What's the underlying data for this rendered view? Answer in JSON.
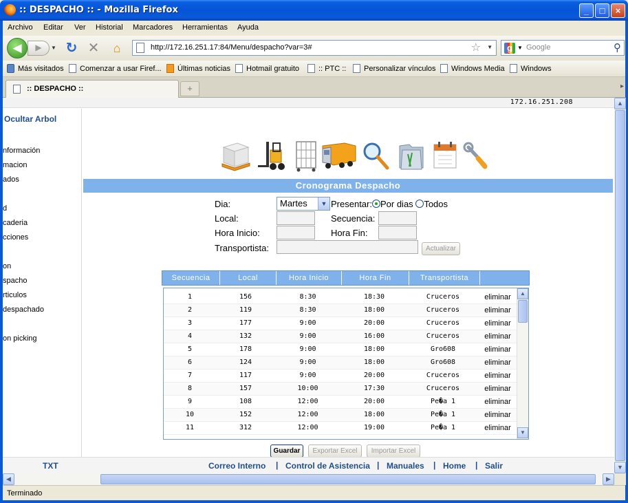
{
  "window": {
    "title": ":: DESPACHO :: - Mozilla Firefox",
    "controls": {
      "minimize": "_",
      "maximize": "□",
      "close": "×"
    }
  },
  "menu": [
    "Archivo",
    "Editar",
    "Ver",
    "Historial",
    "Marcadores",
    "Herramientas",
    "Ayuda"
  ],
  "nav": {
    "url": "http://172.16.251.17:84/Menu/despacho?var=3#",
    "search_placeholder": "Google",
    "icons": {
      "back": "back-arrow-icon",
      "forward": "forward-arrow-icon",
      "reload": "reload-icon",
      "stop": "stop-icon",
      "home": "home-icon",
      "bookmark": "star-icon",
      "search": "magnifier-icon"
    }
  },
  "bookmarks": [
    "Más visitados",
    "Comenzar a usar Firef...",
    "Últimas noticias",
    "Hotmail gratuito",
    ":: PTC ::",
    "Personalizar vínculos",
    "Windows Media",
    "Windows"
  ],
  "tab": {
    "label": ":: DESPACHO ::",
    "new_tab_symbol": "+"
  },
  "page": {
    "ip": "172.16.251.208",
    "sidebar": {
      "toggle": "Ocultar Arbol",
      "items": [
        "nformación",
        "macion",
        "ados",
        "d",
        "caderia",
        "cciones",
        "on",
        "spacho",
        "rticulos",
        " despachado",
        "on picking"
      ]
    },
    "toolbar_icons": [
      "pallet-icon",
      "forklift-icon",
      "cage-cart-icon",
      "truck-icon",
      "search-icon",
      "folders-icon",
      "calendar-icon",
      "tools-icon"
    ],
    "header": "Cronograma Despacho",
    "form": {
      "dia_label": "Dia:",
      "dia_value": "Martes",
      "presentar_label": "Presentar:",
      "option_days": "Por dias",
      "option_all": "Todos",
      "local_label": "Local:",
      "secuencia_label": "Secuencia:",
      "hora_inicio_label": "Hora Inicio:",
      "hora_fin_label": "Hora Fin:",
      "transportista_label": "Transportista:",
      "actualizar": "Actualizar"
    },
    "table": {
      "columns": [
        "Secuencia",
        "Local",
        "Hora Inicio",
        "Hora Fin",
        "Transportista",
        ""
      ],
      "rows": [
        [
          "1",
          "156",
          "8:30",
          "18:30",
          "Cruceros",
          "eliminar"
        ],
        [
          "2",
          "119",
          "8:30",
          "18:00",
          "Cruceros",
          "eliminar"
        ],
        [
          "3",
          "177",
          "9:00",
          "20:00",
          "Cruceros",
          "eliminar"
        ],
        [
          "4",
          "132",
          "9:00",
          "16:00",
          "Cruceros",
          "eliminar"
        ],
        [
          "5",
          "178",
          "9:00",
          "18:00",
          "Gro608",
          "eliminar"
        ],
        [
          "6",
          "124",
          "9:00",
          "18:00",
          "Gro608",
          "eliminar"
        ],
        [
          "7",
          "117",
          "9:00",
          "20:00",
          "Cruceros",
          "eliminar"
        ],
        [
          "8",
          "157",
          "10:00",
          "17:30",
          "Cruceros",
          "eliminar"
        ],
        [
          "9",
          "108",
          "12:00",
          "20:00",
          "Pe�a 1",
          "eliminar"
        ],
        [
          "10",
          "152",
          "12:00",
          "18:00",
          "Pe�a 1",
          "eliminar"
        ],
        [
          "11",
          "312",
          "12:00",
          "19:00",
          "Pe�a 1",
          "eliminar"
        ]
      ]
    },
    "buttons": {
      "guardar": "Guardar",
      "exportar": "Exportar Excel",
      "importar": "Importar Excel"
    },
    "footer": {
      "txt": "TXT",
      "links": [
        "Correo Interno",
        "Control de Asistencia",
        "Manuales",
        "Home",
        "Salir"
      ],
      "separator": "|"
    }
  },
  "status": "Terminado"
}
